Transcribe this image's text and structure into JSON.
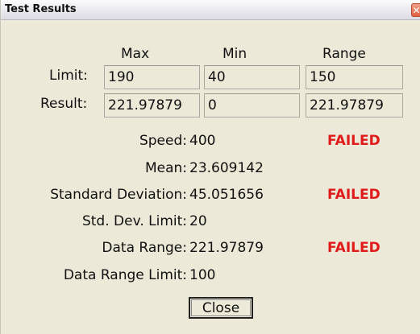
{
  "window": {
    "title": "Test Results",
    "close_glyph": "✕"
  },
  "columns": {
    "max": "Max",
    "min": "Min",
    "range": "Range"
  },
  "limit_row": {
    "label": "Limit:",
    "max": "190",
    "min": "40",
    "range": "150"
  },
  "result_row": {
    "label": "Result:",
    "max": "221.97879",
    "min": "0",
    "range": "221.97879"
  },
  "stats": {
    "speed_label": "Speed:",
    "speed_value": "400",
    "speed_status": "FAILED",
    "mean_label": "Mean:",
    "mean_value": "23.609142",
    "std_label": "Standard Deviation:",
    "std_value": "45.051656",
    "std_status": "FAILED",
    "std_limit_label": "Std. Dev. Limit:",
    "std_limit_value": "20",
    "range_label": "Data Range:",
    "range_value": "221.97879",
    "range_status": "FAILED",
    "range_limit_label": "Data Range Limit:",
    "range_limit_value": "100"
  },
  "buttons": {
    "close_label": "Close"
  },
  "colors": {
    "failed": "#e11b1b",
    "window_bg": "#ece9d8"
  }
}
